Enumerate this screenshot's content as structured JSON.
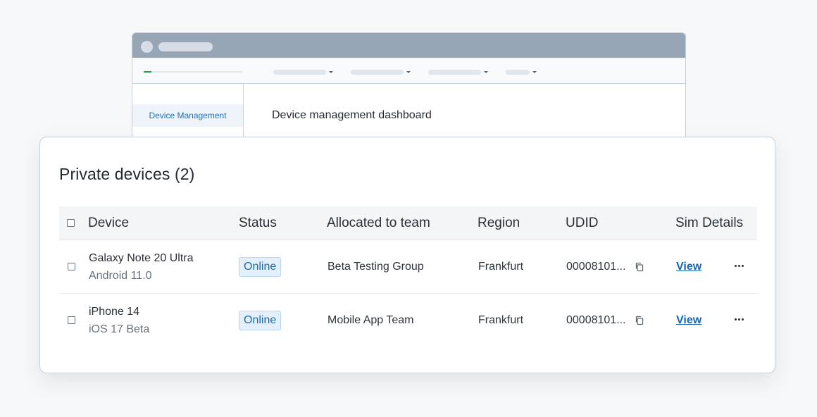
{
  "window": {
    "sidebar_item": "Device Management",
    "page_title": "Device management dashboard",
    "loading_progress": 0.08
  },
  "card": {
    "title": "Private devices (2)"
  },
  "table": {
    "headers": {
      "device": "Device",
      "status": "Status",
      "team": "Allocated to team",
      "region": "Region",
      "udid": "UDID",
      "sim": "Sim Details"
    },
    "rows": [
      {
        "name": "Galaxy Note 20 Ultra",
        "os": "Android 11.0",
        "status": "Online",
        "team": "Beta Testing Group",
        "region": "Frankfurt",
        "udid": "00008101...",
        "sim": "View"
      },
      {
        "name": "iPhone 14",
        "os": "iOS 17 Beta",
        "status": "Online",
        "team": "Mobile App Team",
        "region": "Frankfurt",
        "udid": "00008101...",
        "sim": "View"
      }
    ]
  },
  "colors": {
    "accent": "#1565b8",
    "status_bg": "#e3f0fb",
    "progress": "#27a243",
    "titlebar": "#97a6b7"
  },
  "icons": {
    "copy": "copy-icon",
    "more": "more-icon",
    "checkbox": "checkbox"
  }
}
